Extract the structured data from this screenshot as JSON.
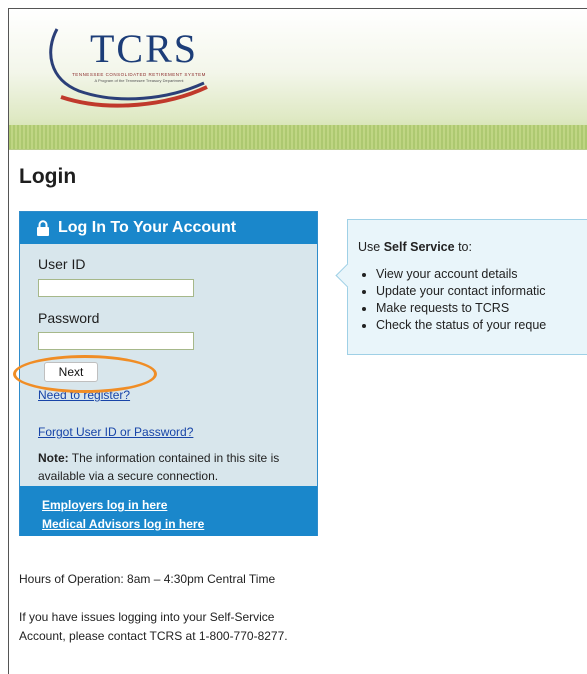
{
  "header": {
    "logo_text": "TCRS",
    "logo_tagline": "TENNESSEE CONSOLIDATED RETIREMENT SYSTEM",
    "logo_subtagline": "A Program of the Tennessee Treasury Department"
  },
  "page": {
    "title": "Login"
  },
  "login": {
    "heading": "Log In To Your Account",
    "user_id_label": "User ID",
    "user_id_value": "",
    "password_label": "Password",
    "password_value": "",
    "next_label": "Next",
    "register_link": "Need to register?",
    "forgot_link": "Forgot User ID or Password?",
    "note_label": "Note:",
    "note_text": " The information contained in this site is available via a secure connection.",
    "employers_link": "Employers log in here",
    "medical_link": "Medical Advisors log in here"
  },
  "info": {
    "intro_pre": "Use ",
    "intro_bold": "Self Service",
    "intro_post": " to:",
    "items": [
      "View your account details",
      "Update your contact informatic",
      "Make requests to TCRS",
      "Check the status of your reque"
    ]
  },
  "footer": {
    "hours": "Hours of Operation: 8am – 4:30pm Central Time",
    "issues": "If you have issues logging into your Self-Service Account, please contact TCRS at 1-800-770-8277."
  },
  "colors": {
    "accent_blue": "#1a87cb",
    "highlight_orange": "#f08d25",
    "logo_navy": "#1c3d78"
  },
  "icons": {
    "lock": "lock-icon"
  }
}
